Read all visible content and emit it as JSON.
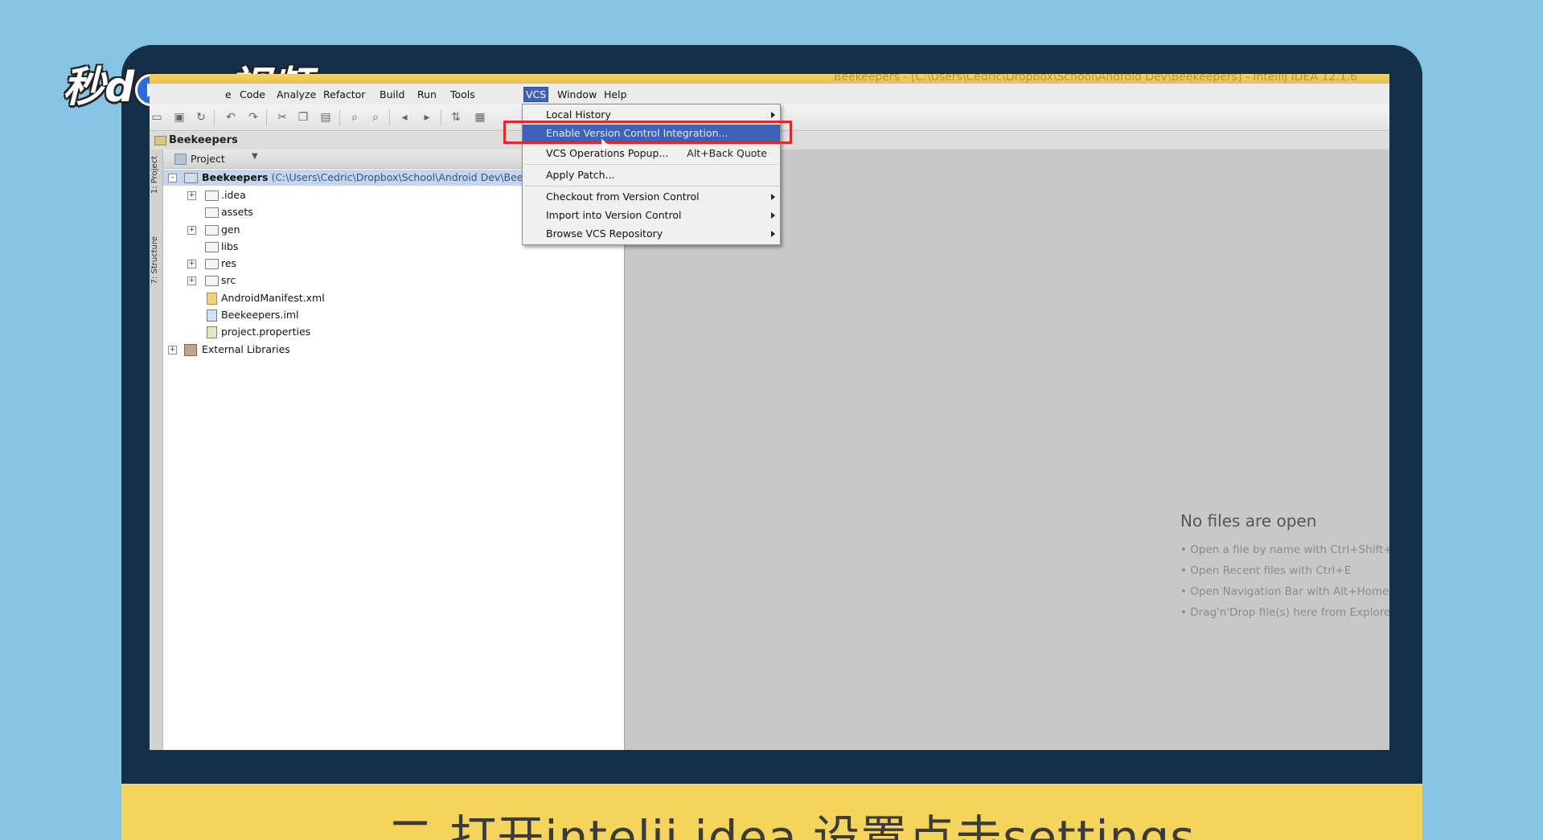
{
  "watermark": {
    "logo_text_left": "秒d",
    "logo_text_right": "ng视频"
  },
  "window": {
    "title": "Beekeepers - [C:\\Users\\Cedric\\Dropbox\\School\\Android Dev\\Beekeepers] - IntelliJ IDEA 12.1.6"
  },
  "menubar": {
    "items": [
      "e",
      "Code",
      "Analyze",
      "Refactor",
      "Build",
      "Run",
      "Tools",
      "VCS",
      "Window",
      "Help"
    ],
    "active": "VCS"
  },
  "navigation": {
    "crumb": "Beekeepers"
  },
  "side_tabs": {
    "project": "1: Project",
    "structure": "7: Structure"
  },
  "project_panel": {
    "view_label": "Project",
    "root": {
      "name": "Beekeepers",
      "path": "(C:\\Users\\Cedric\\Dropbox\\School\\Android Dev\\Beekee"
    },
    "children": [
      ".idea",
      "assets",
      "gen",
      "libs",
      "res",
      "src",
      "AndroidManifest.xml",
      "Beekeepers.iml",
      "project.properties"
    ],
    "external": "External Libraries"
  },
  "vcs_menu": {
    "items": [
      {
        "label": "Local History",
        "shortcut": "",
        "submenu": true
      },
      {
        "label": "Enable Version Control Integration...",
        "shortcut": "",
        "submenu": false
      },
      {
        "label": "VCS Operations Popup...",
        "shortcut": "Alt+Back Quote",
        "submenu": false
      },
      {
        "label": "Apply Patch...",
        "shortcut": "",
        "submenu": false
      },
      {
        "label": "Checkout from Version Control",
        "shortcut": "",
        "submenu": true
      },
      {
        "label": "Import into Version Control",
        "shortcut": "",
        "submenu": true
      },
      {
        "label": "Browse VCS Repository",
        "shortcut": "",
        "submenu": true
      }
    ],
    "highlighted_index": 1
  },
  "editor": {
    "empty_title": "No files are open",
    "hints": [
      "• Open a file by name with Ctrl+Shift+N",
      "• Open Recent files with Ctrl+E",
      "• Open Navigation Bar with Alt+Home",
      "• Drag'n'Drop file(s) here from Explorer"
    ]
  },
  "subtitle": {
    "text": "二 打开intelij idea 设置点击settings"
  },
  "colors": {
    "background": "#87c3e3",
    "bezel": "#142f48",
    "subtitle_bar": "#f5d45c",
    "highlight": "#e3262a",
    "menu_selection": "#3d62b8"
  }
}
